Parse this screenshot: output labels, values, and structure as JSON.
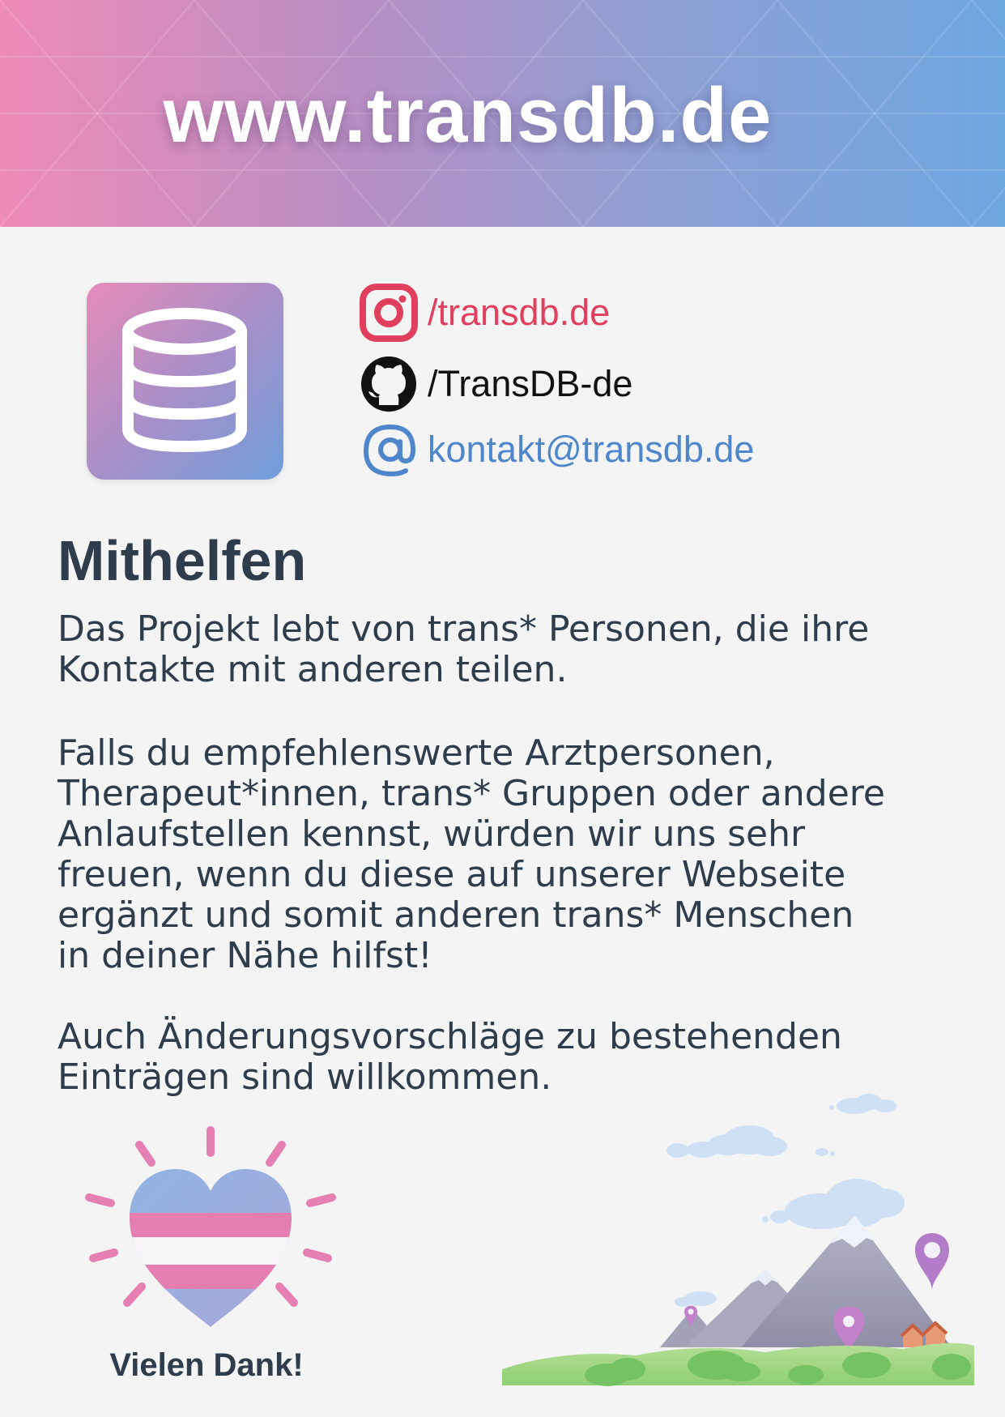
{
  "header": {
    "url": "www.transdb.de"
  },
  "contacts": {
    "instagram": {
      "icon": "instagram-icon",
      "label": "/transdb.de",
      "color": "#e0405e"
    },
    "github": {
      "icon": "github-icon",
      "label": "/TransDB-de",
      "color": "#111111"
    },
    "email": {
      "icon": "at-icon",
      "label": "kontakt@transdb.de",
      "color": "#4f86cc"
    }
  },
  "logo": {
    "icon": "database-icon"
  },
  "section": {
    "title": "Mithelfen",
    "paragraphs": [
      "Das Projekt lebt von trans* Personen, die ihre\nKontakte mit anderen teilen.",
      "Falls du empfehlenswerte Arztpersonen,\nTherapeut*innen, trans* Gruppen oder andere\nAnlaufstellen kennst, würden wir uns sehr\nfreuen, wenn du diese auf unserer Webseite\nergänzt und somit anderen trans* Menschen\nin deiner Nähe hilfst!",
      "Auch Änderungsvorschläge zu bestehenden\nEinträgen sind willkommen."
    ]
  },
  "thanks": {
    "label": "Vielen Dank!",
    "icon": "trans-flag-heart-icon"
  },
  "illustration": {
    "icon": "mountain-landscape-icon"
  },
  "colors": {
    "text": "#2f3c4b",
    "pink": "#ee8bb8",
    "blue": "#6ea6e0",
    "background": "#f4f4f5"
  }
}
